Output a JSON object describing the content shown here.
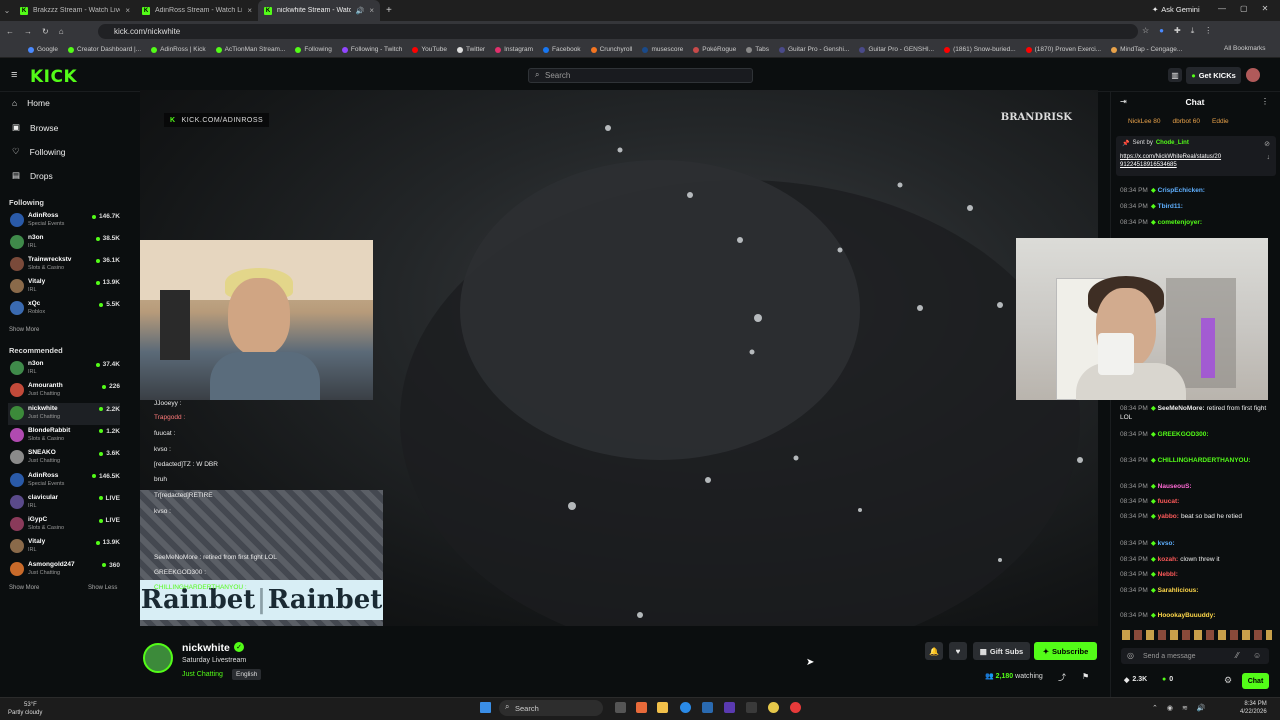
{
  "browser": {
    "tabs": [
      {
        "title": "Brakzzz Stream - Watch Live o..."
      },
      {
        "title": "AdinRoss Stream - Watch Live o..."
      },
      {
        "title": "nickwhite Stream - Watch L..."
      }
    ],
    "url": "kick.com/nickwhite",
    "ask_gemini": "Ask Gemini",
    "bookmarks": [
      "Google",
      "Creator Dashboard |...",
      "AdinRoss | Kick",
      "AcTionMan Stream...",
      "Following",
      "Following - Twitch",
      "YouTube",
      "Twitter",
      "Instagram",
      "Facebook",
      "Crunchyroll",
      "musescore",
      "PokéRogue",
      "Tabs",
      "Guitar Pro - Genshi...",
      "Guitar Pro - GENSHI...",
      "(1861) Snow-buried...",
      "(1870) Proven Exerci...",
      "MindTap - Cengage..."
    ],
    "all_bookmarks": "All Bookmarks"
  },
  "header": {
    "logo": "KICK",
    "search_placeholder": "Search",
    "get_kicks": "Get KICKs"
  },
  "sidebar": {
    "nav": [
      "Home",
      "Browse",
      "Following",
      "Drops"
    ],
    "following_title": "Following",
    "following": [
      {
        "name": "AdinRoss",
        "category": "Special Events",
        "viewers": "146.7K",
        "color": "#2a5aa8"
      },
      {
        "name": "n3on",
        "category": "IRL",
        "viewers": "38.5K",
        "color": "#3f8a4a"
      },
      {
        "name": "Trainwreckstv",
        "category": "Slots & Casino",
        "viewers": "36.1K",
        "color": "#7a4a3a"
      },
      {
        "name": "Vitaly",
        "category": "IRL",
        "viewers": "13.9K",
        "color": "#8a6a4a"
      },
      {
        "name": "xQc",
        "category": "Roblox",
        "viewers": "5.5K",
        "color": "#3a6ab0"
      }
    ],
    "show_more_1": "Show More",
    "recommended_title": "Recommended",
    "recommended": [
      {
        "name": "n3on",
        "category": "IRL",
        "viewers": "37.4K",
        "color": "#3f8a4a"
      },
      {
        "name": "Amouranth",
        "category": "Just Chatting",
        "viewers": "226",
        "color": "#c24a3a"
      },
      {
        "name": "nickwhite",
        "category": "Just Chatting",
        "viewers": "2.2K",
        "color": "#3c8a3a"
      },
      {
        "name": "BlondeRabbit",
        "category": "Slots & Casino",
        "viewers": "1.2K",
        "color": "#b04ab0"
      },
      {
        "name": "SNEAKO",
        "category": "Just Chatting",
        "viewers": "3.6K",
        "color": "#8a8a8a"
      },
      {
        "name": "AdinRoss",
        "category": "Special Events",
        "viewers": "146.5K",
        "color": "#2a5aa8"
      },
      {
        "name": "clavicular",
        "category": "IRL",
        "viewers": "LIVE",
        "color": "#5a4a8a"
      },
      {
        "name": "iGypC",
        "category": "Slots & Casino",
        "viewers": "LIVE",
        "color": "#8a3a5a"
      },
      {
        "name": "Vitaly",
        "category": "IRL",
        "viewers": "13.9K",
        "color": "#8a6a4a"
      },
      {
        "name": "Asmongold247",
        "category": "Just Chatting",
        "viewers": "360",
        "color": "#c86a2a"
      }
    ],
    "show_more_2": "Show More",
    "show_less": "Show Less"
  },
  "video": {
    "watermark": "KICK.COM/ADINROSS",
    "brand": "BRANDRISK",
    "overlay_chat": [
      "JJooeyy :",
      "Trapgodd :",
      "fuucat :",
      "kvso :",
      "[redacted]TZ : W DBR",
      "bruh",
      "Tr[redacted]RETIRE",
      "kvso :",
      "SeeMeNoMore : retired from first fight LOL",
      "GREEKGOD300 :",
      "CHILLINGHARDERTHANYOU :",
      "Rainbet"
    ]
  },
  "stream": {
    "name": "nickwhite",
    "title": "Saturday Livestream",
    "category": "Just Chatting",
    "language": "English",
    "gift_subs": "Gift Subs",
    "subscribe": "Subscribe",
    "viewers": "2,180",
    "watching": "watching"
  },
  "chat": {
    "title": "Chat",
    "top_gifters": [
      "NickLee 80",
      "dbrbot 60",
      "Eddie"
    ],
    "pinned_by": "Sent by",
    "pinned_user": "Chode_Lint",
    "pinned_link": "https://x.com/NickWhiteReal/status/20 91224518916534685",
    "messages": [
      {
        "time": "08:34 PM",
        "user": "CrispEchicken:",
        "text": "",
        "color": "#5fb0ff"
      },
      {
        "time": "08:34 PM",
        "user": "Tbird11:",
        "text": "",
        "color": "#5fb0ff"
      },
      {
        "time": "08:34 PM",
        "user": "cometenjoyer:",
        "text": "",
        "color": "#53fc18"
      },
      {
        "time": "08:34 PM",
        "user": "stonedgut:",
        "text": "",
        "color": "#5fb0ff"
      },
      {
        "time": "08:34 PM",
        "user": "SeeMeNoMore:",
        "text": "retired from first fight LOL",
        "color": "#e8e8e8"
      },
      {
        "time": "08:34 PM",
        "user": "GREEKGOD300:",
        "text": "",
        "color": "#53fc18"
      },
      {
        "time": "08:34 PM",
        "user": "CHILLINGHARDERTHANYOU:",
        "text": "",
        "color": "#53fc18"
      },
      {
        "time": "08:34 PM",
        "user": "NauseouS:",
        "text": "",
        "color": "#ff6ad5"
      },
      {
        "time": "08:34 PM",
        "user": "fuucat:",
        "text": "",
        "color": "#ff5a5a"
      },
      {
        "time": "08:34 PM",
        "user": "yabbo:",
        "text": "beat so bad he retied",
        "color": "#ff5a5a"
      },
      {
        "time": "08:34 PM",
        "user": "kvso:",
        "text": "",
        "color": "#5fb0ff"
      },
      {
        "time": "08:34 PM",
        "user": "kozah:",
        "text": "clown threw it",
        "color": "#ff5a5a"
      },
      {
        "time": "08:34 PM",
        "user": "Nebbl:",
        "text": "",
        "color": "#ff5a5a"
      },
      {
        "time": "08:34 PM",
        "user": "Sarahlicious:",
        "text": "",
        "color": "#ffd84a"
      },
      {
        "time": "08:34 PM",
        "user": "HoookayBuuuddy:",
        "text": "",
        "color": "#ffd84a"
      }
    ],
    "input_placeholder": "Send a message",
    "points": "2.3K",
    "kicks": "0",
    "chat_button": "Chat"
  },
  "taskbar": {
    "weather_temp": "53°F",
    "weather_desc": "Partly cloudy",
    "search": "Search",
    "time": "8:34 PM",
    "date": "4/22/2026"
  }
}
